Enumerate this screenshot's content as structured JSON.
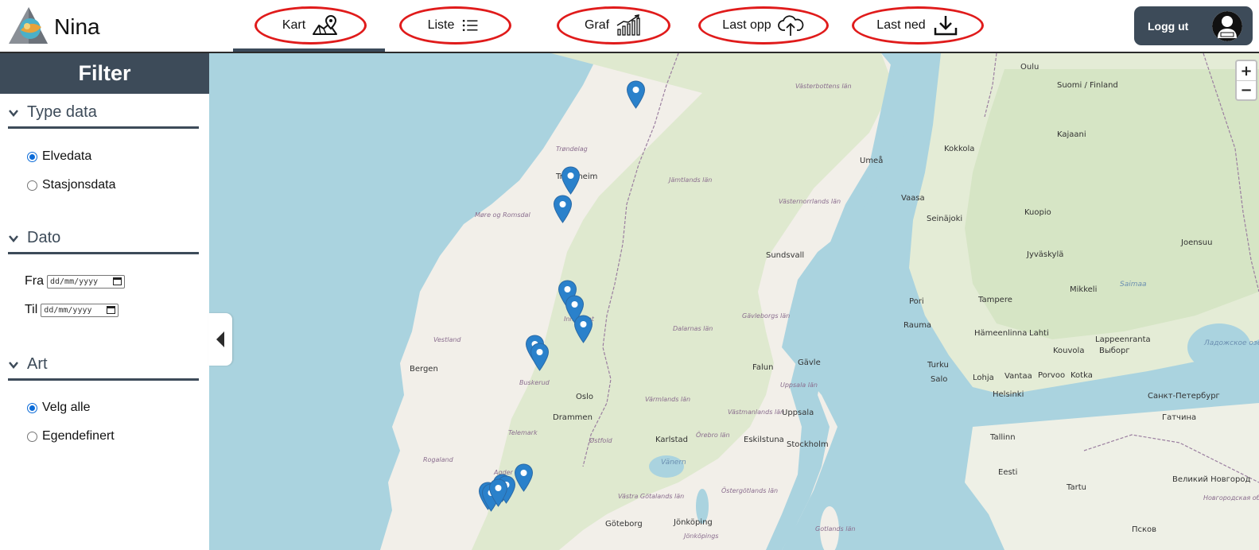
{
  "app": {
    "name": "Nina",
    "brand_color": "#3d4b59",
    "highlight_color": "#e01b1b"
  },
  "nav": {
    "items": [
      {
        "label": "Kart",
        "icon": "map-pin-icon"
      },
      {
        "label": "Liste",
        "icon": "list-icon"
      },
      {
        "label": "Graf",
        "icon": "bar-chart-icon"
      },
      {
        "label": "Last opp",
        "icon": "cloud-upload-icon"
      },
      {
        "label": "Last ned",
        "icon": "download-icon"
      }
    ],
    "active": "Kart",
    "logout_label": "Logg ut"
  },
  "sidebar": {
    "title": "Filter",
    "sections": {
      "type_data": {
        "title": "Type data",
        "options": [
          "Elvedata",
          "Stasjonsdata"
        ],
        "selected": "Elvedata"
      },
      "dato": {
        "title": "Dato",
        "from_label": "Fra",
        "to_label": "Til",
        "from_placeholder": "dd/mm/yyyy",
        "to_placeholder": "dd/mm/yyyy"
      },
      "art": {
        "title": "Art",
        "options": [
          "Velg alle",
          "Egendefinert"
        ],
        "selected": "Velg alle"
      }
    }
  },
  "map": {
    "zoom_in": "+",
    "zoom_out": "−",
    "marker_color": "#2a81cb",
    "marker_count": 14,
    "places": [
      "Oulu",
      "Suomi / Finland",
      "Västerbottens län",
      "Kokkola",
      "Kajaani",
      "Trøndelag",
      "Trondheim",
      "Umeå",
      "Jämtlands län",
      "Vaasa",
      "Seinäjoki",
      "Kuopio",
      "Møre og Romsdal",
      "Västernorrlands län",
      "Sundsvall",
      "Joensuu",
      "Jyväskylä",
      "Mikkeli",
      "Saimaa",
      "Pori",
      "Tampere",
      "Innlandet",
      "Gävleborgs län",
      "Rauma",
      "Hämeenlinna",
      "Lahti",
      "Kouvola",
      "Lappeenranta",
      "Выборг",
      "Ладожское озеро",
      "Vestland",
      "Dalarnas län",
      "Falun",
      "Gävle",
      "Turku",
      "Salo",
      "Lohja",
      "Vantaa",
      "Porvoo",
      "Kotka",
      "Helsinki",
      "Санкт-Петербург",
      "Bergen",
      "Buskerud",
      "Oslo",
      "Uppsala län",
      "Drammen",
      "Värmlands län",
      "Västmanlands län",
      "Uppsala",
      "Гатчина",
      "Telemark",
      "Østfold",
      "Karlstad",
      "Örebro län",
      "Eskilstuna",
      "Stockholm",
      "Tallinn",
      "Rogaland",
      "Vänern",
      "Agder",
      "Eesti",
      "Великий Новгород",
      "Västra Götalands län",
      "Östergötlands län",
      "Tartu",
      "Новгородская область",
      "Göteborg",
      "Jönköping",
      "Jönköpings",
      "Gotlands län",
      "Псков"
    ]
  }
}
